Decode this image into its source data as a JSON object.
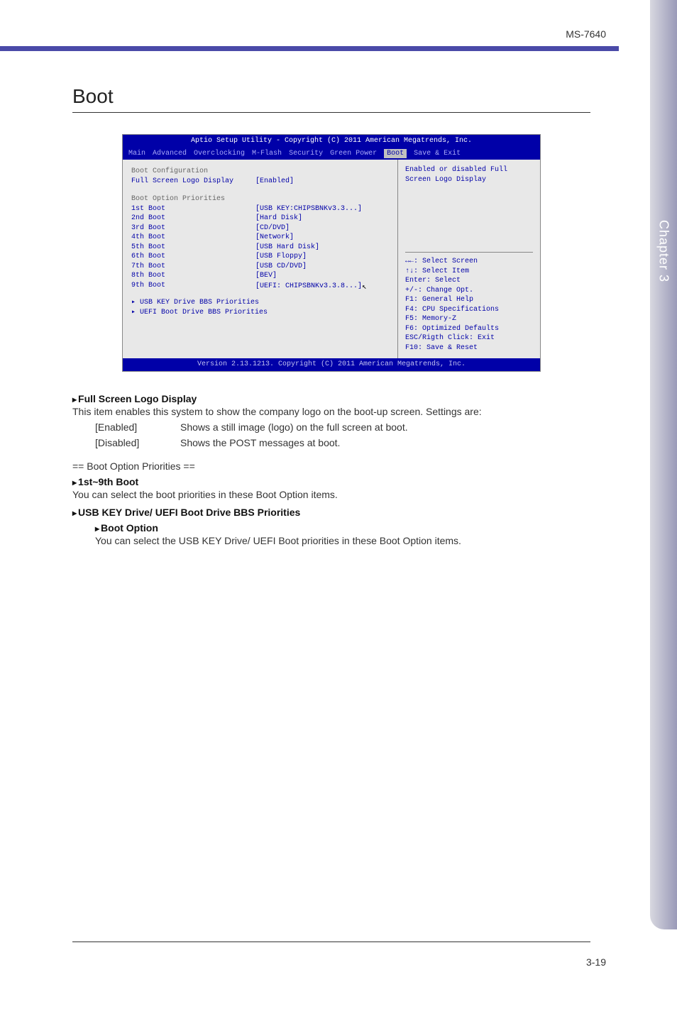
{
  "header": {
    "model": "MS-7640"
  },
  "sidebar_tab": "Chapter 3",
  "page_number": "3-19",
  "page_title": "Boot",
  "bios": {
    "title": "Aptio Setup Utility - Copyright (C) 2011 American Megatrends, Inc.",
    "tabs": [
      "Main",
      "Advanced",
      "Overclocking",
      "M-Flash",
      "Security",
      "Green Power",
      "Boot",
      "Save & Exit"
    ],
    "active_tab": "Boot",
    "config_header": "Boot Configuration",
    "full_screen_logo": {
      "label": "Full Screen Logo Display",
      "value": "[Enabled]"
    },
    "priorities_header": "Boot Option Priorities",
    "boot_rows": [
      {
        "label": "1st Boot",
        "value": "[USB KEY:CHIPSBNKv3.3...]"
      },
      {
        "label": "2nd Boot",
        "value": "[Hard Disk]"
      },
      {
        "label": "3rd Boot",
        "value": "[CD/DVD]"
      },
      {
        "label": "4th Boot",
        "value": "[Network]"
      },
      {
        "label": "5th Boot",
        "value": "[USB Hard Disk]"
      },
      {
        "label": "6th Boot",
        "value": "[USB Floppy]"
      },
      {
        "label": "7th Boot",
        "value": "[USB CD/DVD]"
      },
      {
        "label": "8th Boot",
        "value": "[BEV]"
      },
      {
        "label": "9th Boot",
        "value": "[UEFI: CHIPSBNKv3.3.8...]"
      }
    ],
    "submenus": [
      "USB KEY Drive BBS Priorities",
      "UEFI Boot Drive BBS Priorities"
    ],
    "help_text": "Enabled or disabled Full Screen Logo Display",
    "nav_help": [
      "↔←: Select Screen",
      "↑↓: Select Item",
      "Enter: Select",
      "+/-: Change Opt.",
      "F1: General Help",
      "F4: CPU Specifications",
      "F5: Memory-Z",
      "F6: Optimized Defaults",
      "ESC/Rigth Click: Exit",
      "F10: Save & Reset"
    ],
    "footer": "Version 2.13.1213. Copyright (C) 2011 American Megatrends, Inc."
  },
  "doc": {
    "full_screen_logo_heading": "Full Screen Logo Display",
    "full_screen_logo_desc": "This item enables this system to show the company logo on the boot-up screen. Settings are:",
    "enabled_key": "[Enabled]",
    "enabled_val": "Shows a still image (logo) on the full screen at boot.",
    "disabled_key": "[Disabled]",
    "disabled_val": "Shows the POST messages at boot.",
    "priorities_sep": "== Boot Option Priorities ==",
    "boot_1_9_heading": "1st~9th Boot",
    "boot_1_9_desc": "You can select the boot priorities in these Boot Option items.",
    "bbs_heading": "USB KEY Drive/ UEFI Boot Drive BBS Priorities",
    "boot_option_heading": "Boot Option",
    "boot_option_desc": "You can select the USB KEY Drive/ UEFI Boot priorities in these Boot Option items."
  }
}
